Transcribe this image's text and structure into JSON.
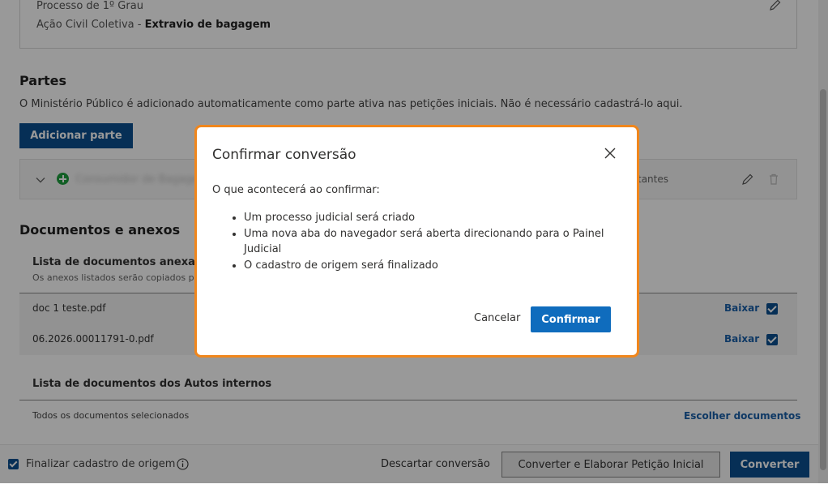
{
  "processo": {
    "grau": "Processo de 1º Grau",
    "classe": "Ação Civil Coletiva - ",
    "assunto": "Extravio de bagagem"
  },
  "partes": {
    "title": "Partes",
    "info": "O Ministério Público é adicionado automaticamente como parte ativa nas petições iniciais. Não é necessário cadastrá-lo aqui.",
    "add_button": "Adicionar parte",
    "row": {
      "name": "Consumidor de Bagagens",
      "role": "tantes"
    }
  },
  "documentos": {
    "title": "Documentos e anexos",
    "list_title": "Lista de documentos anexados",
    "list_subtitle": "Os anexos listados serão copiados para",
    "items": [
      {
        "name": "doc 1 teste.pdf",
        "download": "Baixar",
        "checked": true
      },
      {
        "name": "06.2026.00011791-0.pdf",
        "download": "Baixar",
        "checked": true
      }
    ],
    "autos_title": "Lista de documentos dos Autos internos",
    "autos_text": "Todos os documentos selecionados",
    "autos_link": "Escolher documentos"
  },
  "footer": {
    "finalizar_label": "Finalizar cadastro de origem",
    "finalizar_checked": true,
    "discard": "Descartar conversão",
    "convert_elaborate": "Converter e Elaborar Petição Inicial",
    "convert": "Converter"
  },
  "dialog": {
    "title": "Confirmar conversão",
    "intro": "O que acontecerá ao confirmar:",
    "bullets": [
      "Um processo judicial será criado",
      "Uma nova aba do navegador será aberta direcionando para o Painel Judicial",
      "O cadastro de origem será finalizado"
    ],
    "cancel": "Cancelar",
    "confirm": "Confirmar"
  },
  "colors": {
    "primary": "#0a4f8f",
    "confirm": "#0f6cbd",
    "dialog_border": "#f0861c",
    "success": "#1e9e3e"
  }
}
